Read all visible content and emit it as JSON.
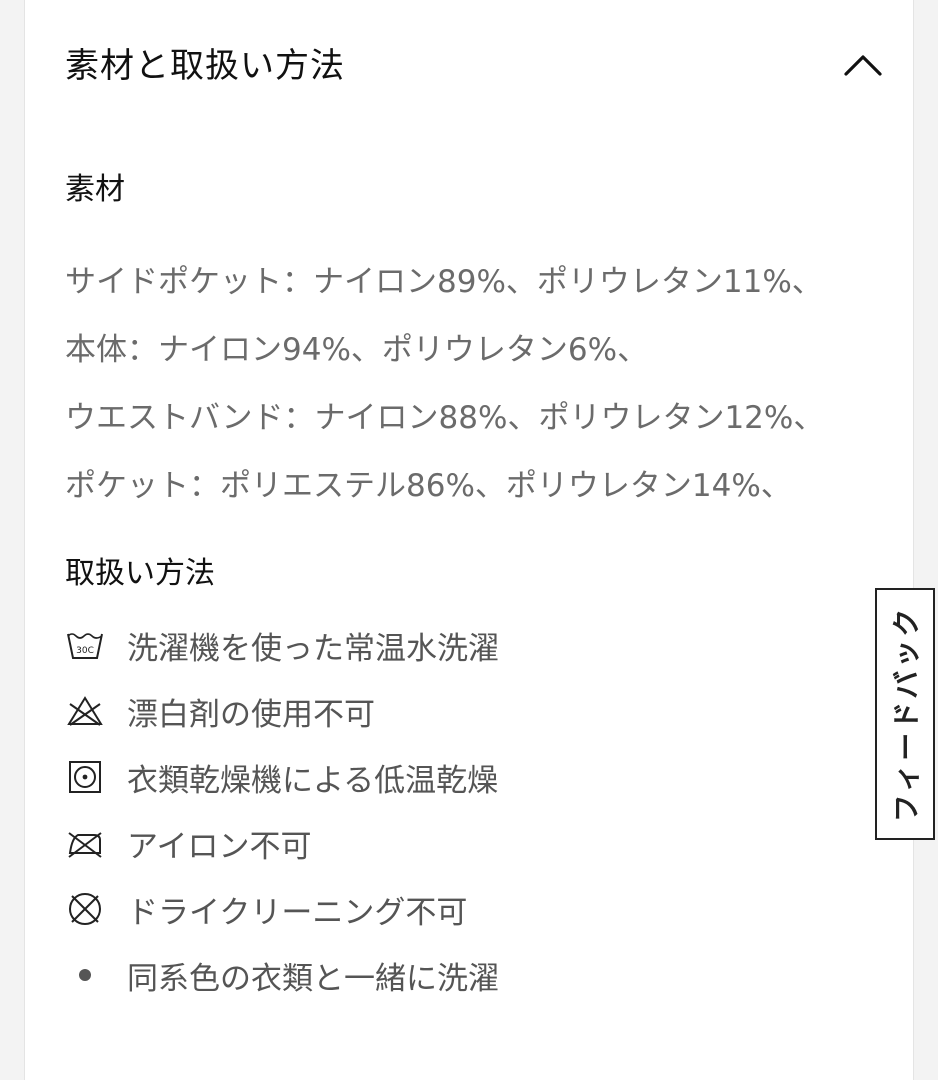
{
  "section": {
    "title": "素材と取扱い方法",
    "toggle_icon": "chevron-up-icon"
  },
  "materials": {
    "heading": "素材",
    "lines": [
      "サイドポケット：ナイロン89%、ポリウレタン11%、",
      "本体：ナイロン94%、ポリウレタン6%、",
      "ウエストバンド：ナイロン88%、ポリウレタン12%、",
      "ポケット：ポリエステル86%、ポリウレタン14%、"
    ]
  },
  "care": {
    "heading": "取扱い方法",
    "items": [
      {
        "icon": "wash-30c-icon",
        "icon_text": "30C",
        "label": "洗濯機を使った常温水洗濯"
      },
      {
        "icon": "no-bleach-icon",
        "label": "漂白剤の使用不可"
      },
      {
        "icon": "tumble-dry-low-icon",
        "label": "衣類乾燥機による低温乾燥"
      },
      {
        "icon": "no-iron-icon",
        "label": "アイロン不可"
      },
      {
        "icon": "no-dry-clean-icon",
        "label": "ドライクリーニング不可"
      },
      {
        "icon": "bullet-icon",
        "label": "同系色の衣類と一緒に洗濯"
      }
    ]
  },
  "feedback": {
    "label": "フィードバック"
  }
}
